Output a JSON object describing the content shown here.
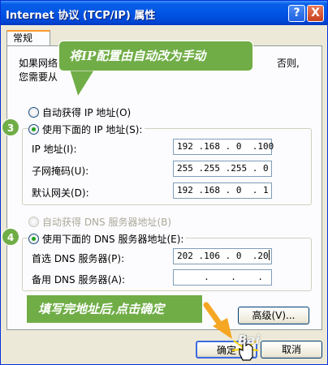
{
  "window": {
    "title": "Internet 协议 (TCP/IP) 属性",
    "help_label": "?",
    "close_label": "X"
  },
  "tab": {
    "label": "常规"
  },
  "description": {
    "line1_left": "如果网络",
    "line1_right": "否则,",
    "line2_left": "您需要从"
  },
  "ip_mode": {
    "auto_label": "自动获得 IP 地址(O)",
    "manual_label": "使用下面的 IP 地址(S):",
    "selected": "manual"
  },
  "ip_fields": [
    {
      "label": "IP 地址(I):",
      "value": "192 .168 . 0  .100"
    },
    {
      "label": "子网掩码(U):",
      "value": "255 .255 .255 . 0"
    },
    {
      "label": "默认网关(D):",
      "value": "192 .168 . 0  . 1"
    }
  ],
  "dns_mode": {
    "auto_label": "自动获得 DNS 服务器地址(B)",
    "manual_label": "使用下面的 DNS 服务器地址(E):",
    "selected": "manual"
  },
  "dns_fields": [
    {
      "label": "首选 DNS 服务器(P):",
      "value": "202 .106 . 0  .20"
    },
    {
      "label": "备用 DNS 服务器(A):",
      "value": "     .    .    .   "
    }
  ],
  "buttons": {
    "advanced": "高级(V)...",
    "ok": "确定",
    "cancel": "取消"
  },
  "annotations": {
    "callout_top": "将IP配置由自动改为手动",
    "callout_bottom": "填写完地址后,点击确定",
    "badge_3": "3",
    "badge_4": "4",
    "watermark": "Bai"
  },
  "colors": {
    "titlebar": "#0055e5",
    "callout_green": "#70ad47",
    "panel_bg": "#fcfcfe",
    "window_bg": "#ece9d8"
  }
}
